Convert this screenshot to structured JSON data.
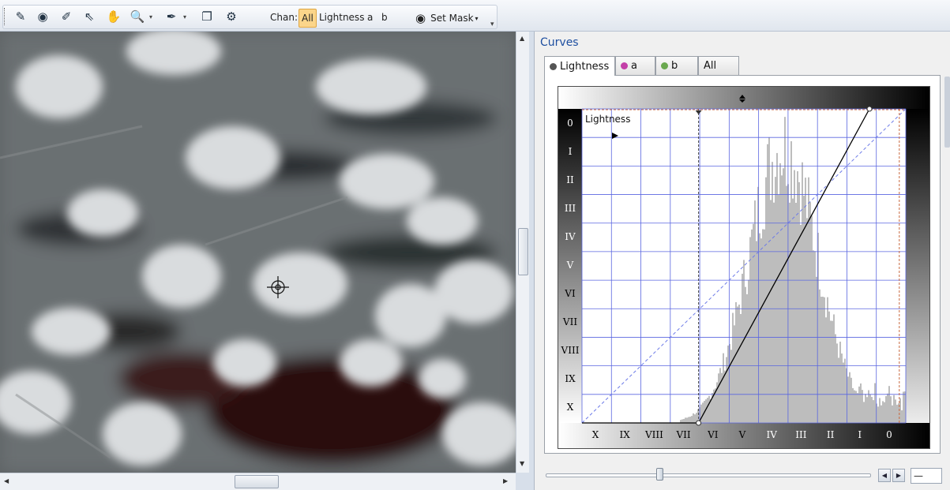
{
  "toolbar": {
    "tools": [
      {
        "id": "paint-tool",
        "icon": "curve-pen-icon",
        "glyph": "✎"
      },
      {
        "id": "mask-tool",
        "icon": "mask-icon",
        "glyph": "◉"
      },
      {
        "id": "brush-tool",
        "icon": "edit-path-icon",
        "glyph": "✐"
      },
      {
        "id": "select-tool",
        "icon": "arrow-pointer-icon",
        "glyph": "⇖"
      },
      {
        "id": "hand-tool",
        "icon": "hand-pan-icon",
        "glyph": "✋"
      },
      {
        "id": "zoom-tool",
        "icon": "magnifier-icon",
        "glyph": "🔍"
      },
      {
        "id": "eyedropper-tool",
        "icon": "eyedropper-icon",
        "glyph": "✒"
      },
      {
        "id": "copy-tool",
        "icon": "copy-icon",
        "glyph": "❐"
      },
      {
        "id": "settings-tool",
        "icon": "wrench-icon",
        "glyph": "⚙"
      }
    ],
    "chan_label": "Chan:",
    "channels": [
      "All",
      "Lightness",
      "a",
      "b"
    ],
    "active_channel": "All",
    "set_mask_label": "Set Mask"
  },
  "panel": {
    "title": "Curves",
    "tabs": [
      {
        "label": "Lightness",
        "dot": "#555555"
      },
      {
        "label": "a",
        "dot": "#c33fa8"
      },
      {
        "label": "b",
        "dot": "#6aa84f"
      },
      {
        "label": "All",
        "dot": ""
      }
    ],
    "active_tab": "Lightness",
    "graph": {
      "channel_label": "Lightness",
      "y_ticks": [
        "0",
        "I",
        "II",
        "III",
        "IV",
        "V",
        "VI",
        "VII",
        "VIII",
        "IX",
        "X"
      ],
      "x_ticks": [
        "X",
        "IX",
        "VIII",
        "VII",
        "VI",
        "V",
        "IV",
        "III",
        "II",
        "I",
        "0"
      ],
      "curve_points": [
        [
          0.36,
          0
        ],
        [
          1.0,
          1.0
        ]
      ],
      "black_point": 0.36,
      "white_point": 0.98
    },
    "slider_value_fraction": 0.34,
    "value_box": "—"
  },
  "colors": {
    "accent": "#1e4fa0",
    "grid": "#5a66e0",
    "histogram": "#bdbdbd",
    "curve": "#000000",
    "active_channel_bg": "#fbd58a"
  }
}
